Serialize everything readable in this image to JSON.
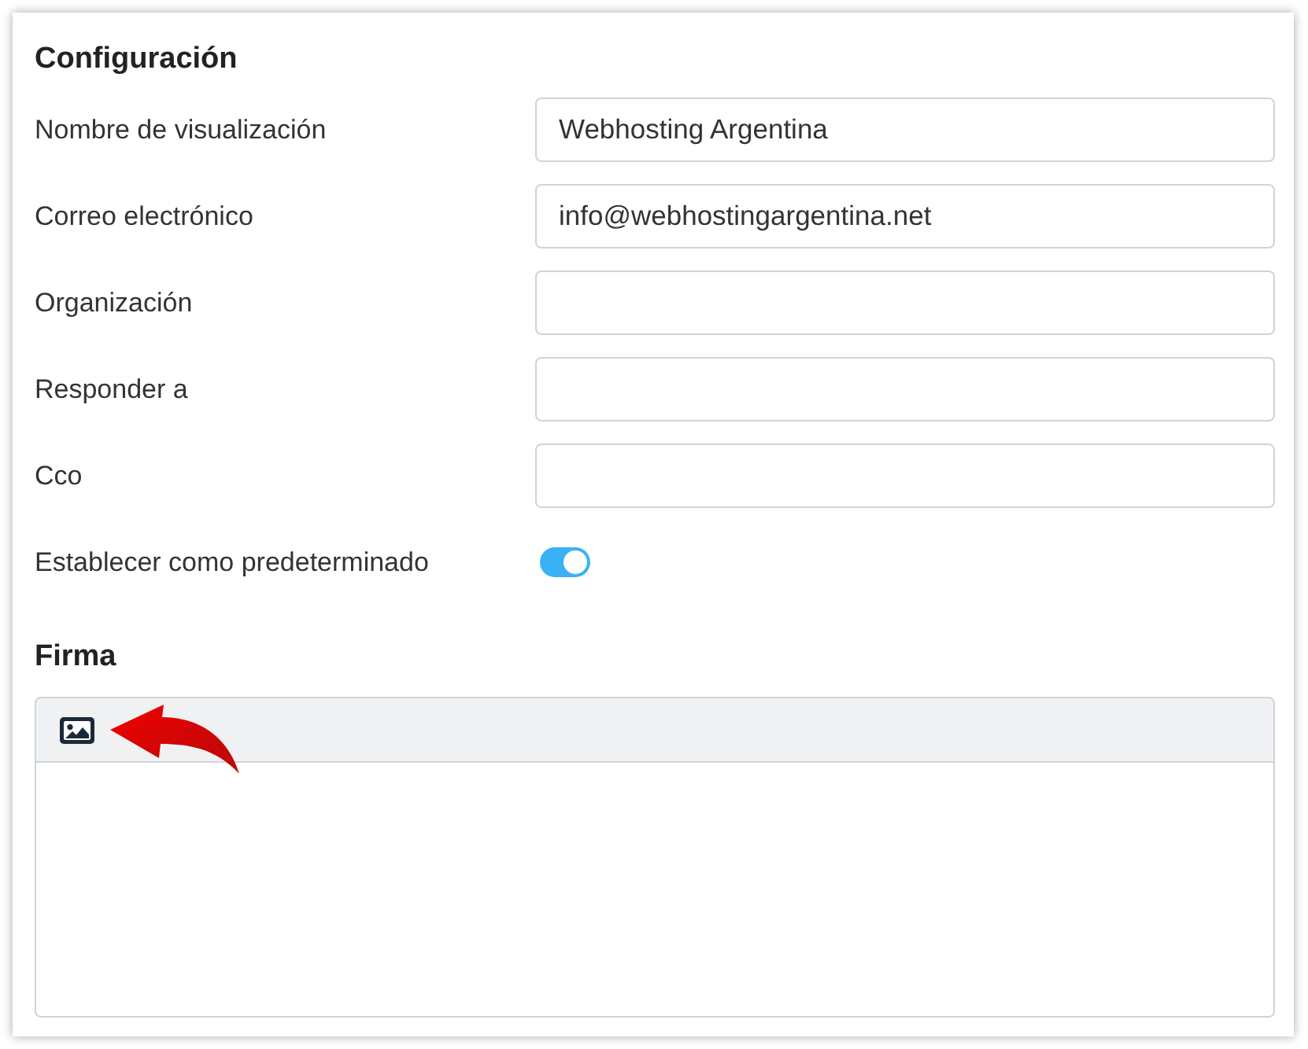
{
  "section_title": "Configuración",
  "fields": [
    {
      "kind": "text",
      "label": "Nombre de visualización",
      "value": "Webhosting Argentina"
    },
    {
      "kind": "text",
      "label": "Correo electrónico",
      "value": "info@webhostingargentina.net"
    },
    {
      "kind": "text",
      "label": "Organización"
    },
    {
      "kind": "text",
      "label": "Responder a"
    },
    {
      "kind": "text",
      "label": "Cco"
    },
    {
      "kind": "toggle",
      "label": "Establecer como predeterminado",
      "on": true
    }
  ],
  "signature": {
    "title": "Firma"
  }
}
